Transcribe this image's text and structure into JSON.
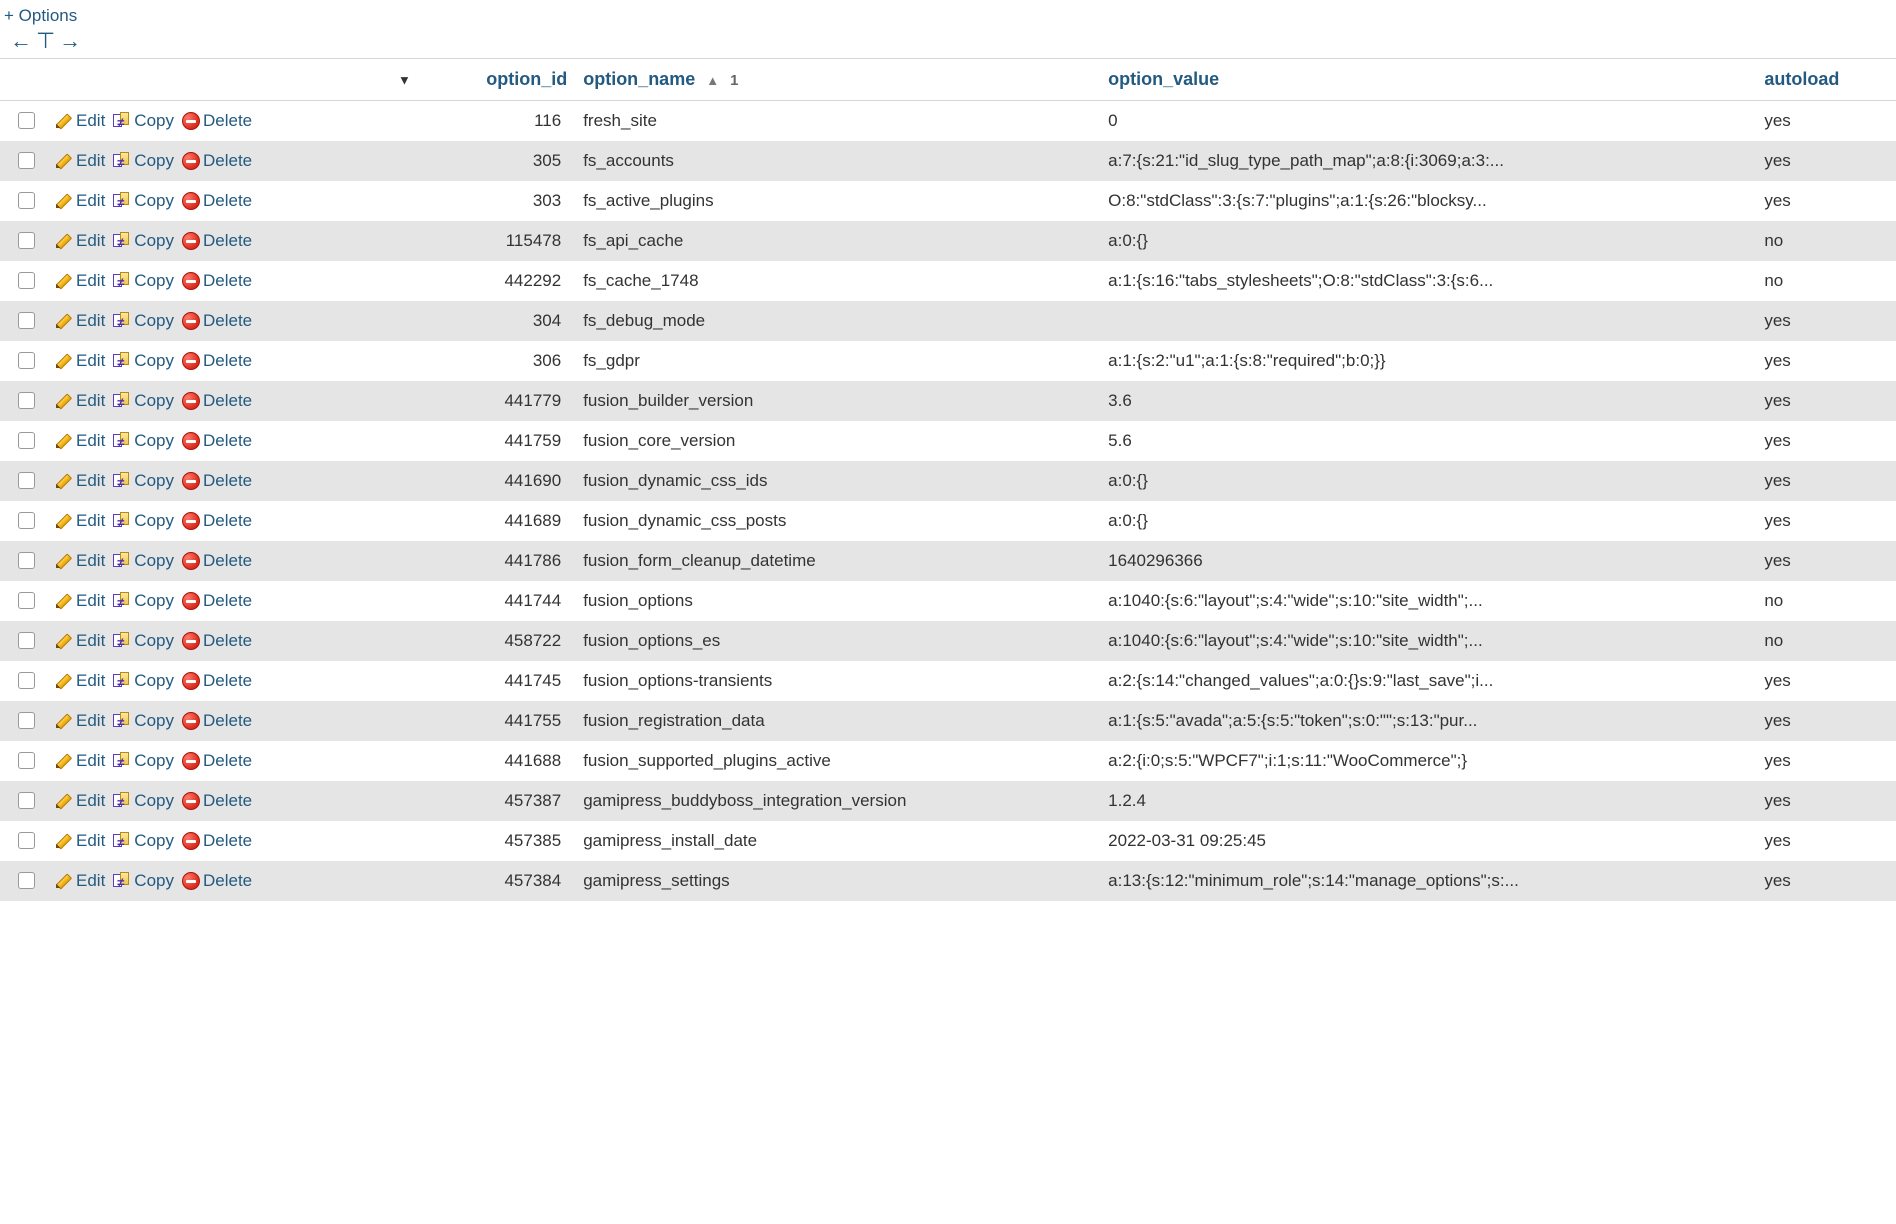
{
  "toolbar": {
    "options_link": "+ Options",
    "arrow_left": "←",
    "arrow_tbar": "⊤",
    "arrow_right": "→"
  },
  "columns": {
    "option_id": "option_id",
    "option_name": "option_name",
    "option_value": "option_value",
    "autoload": "autoload",
    "sort_index": "1"
  },
  "actions": {
    "edit": "Edit",
    "copy": "Copy",
    "delete": "Delete"
  },
  "rows": [
    {
      "option_id": "116",
      "option_name": "fresh_site",
      "option_value": "0",
      "autoload": "yes"
    },
    {
      "option_id": "305",
      "option_name": "fs_accounts",
      "option_value": "a:7:{s:21:\"id_slug_type_path_map\";a:8:{i:3069;a:3:...",
      "autoload": "yes"
    },
    {
      "option_id": "303",
      "option_name": "fs_active_plugins",
      "option_value": "O:8:\"stdClass\":3:{s:7:\"plugins\";a:1:{s:26:\"blocksy...",
      "autoload": "yes"
    },
    {
      "option_id": "115478",
      "option_name": "fs_api_cache",
      "option_value": "a:0:{}",
      "autoload": "no"
    },
    {
      "option_id": "442292",
      "option_name": "fs_cache_1748",
      "option_value": "a:1:{s:16:\"tabs_stylesheets\";O:8:\"stdClass\":3:{s:6...",
      "autoload": "no"
    },
    {
      "option_id": "304",
      "option_name": "fs_debug_mode",
      "option_value": "",
      "autoload": "yes"
    },
    {
      "option_id": "306",
      "option_name": "fs_gdpr",
      "option_value": "a:1:{s:2:\"u1\";a:1:{s:8:\"required\";b:0;}}",
      "autoload": "yes"
    },
    {
      "option_id": "441779",
      "option_name": "fusion_builder_version",
      "option_value": "3.6",
      "autoload": "yes"
    },
    {
      "option_id": "441759",
      "option_name": "fusion_core_version",
      "option_value": "5.6",
      "autoload": "yes"
    },
    {
      "option_id": "441690",
      "option_name": "fusion_dynamic_css_ids",
      "option_value": "a:0:{}",
      "autoload": "yes"
    },
    {
      "option_id": "441689",
      "option_name": "fusion_dynamic_css_posts",
      "option_value": "a:0:{}",
      "autoload": "yes"
    },
    {
      "option_id": "441786",
      "option_name": "fusion_form_cleanup_datetime",
      "option_value": "1640296366",
      "autoload": "yes"
    },
    {
      "option_id": "441744",
      "option_name": "fusion_options",
      "option_value": "a:1040:{s:6:\"layout\";s:4:\"wide\";s:10:\"site_width\";...",
      "autoload": "no"
    },
    {
      "option_id": "458722",
      "option_name": "fusion_options_es",
      "option_value": "a:1040:{s:6:\"layout\";s:4:\"wide\";s:10:\"site_width\";...",
      "autoload": "no"
    },
    {
      "option_id": "441745",
      "option_name": "fusion_options-transients",
      "option_value": "a:2:{s:14:\"changed_values\";a:0:{}s:9:\"last_save\";i...",
      "autoload": "yes"
    },
    {
      "option_id": "441755",
      "option_name": "fusion_registration_data",
      "option_value": "a:1:{s:5:\"avada\";a:5:{s:5:\"token\";s:0:\"\";s:13:\"pur...",
      "autoload": "yes"
    },
    {
      "option_id": "441688",
      "option_name": "fusion_supported_plugins_active",
      "option_value": "a:2:{i:0;s:5:\"WPCF7\";i:1;s:11:\"WooCommerce\";}",
      "autoload": "yes"
    },
    {
      "option_id": "457387",
      "option_name": "gamipress_buddyboss_integration_version",
      "option_value": "1.2.4",
      "autoload": "yes"
    },
    {
      "option_id": "457385",
      "option_name": "gamipress_install_date",
      "option_value": "2022-03-31 09:25:45",
      "autoload": "yes"
    },
    {
      "option_id": "457384",
      "option_name": "gamipress_settings",
      "option_value": "a:13:{s:12:\"minimum_role\";s:14:\"manage_options\";s:...",
      "autoload": "yes"
    }
  ]
}
